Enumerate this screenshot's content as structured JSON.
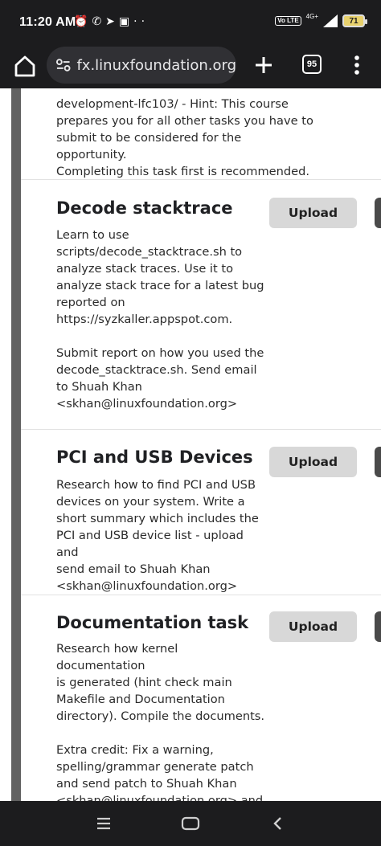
{
  "status_bar": {
    "time": "11:20 AM",
    "left_icons": [
      "alarm-icon",
      "whatsapp-icon",
      "telegram-icon",
      "train-icon",
      "more-dots-icon"
    ],
    "network": "4G+",
    "volte": "Vo LTE",
    "battery": "71"
  },
  "browser": {
    "url": "fx.linuxfoundation.org",
    "tab_count": "95"
  },
  "tasks": [
    {
      "title": "",
      "description": "development-lfc103/ - Hint: This course\nprepares you for all other tasks you have to\nsubmit to be considered for the opportunity.\nCompleting this task first is recommended."
    },
    {
      "title": "Decode stacktrace",
      "upload_label": "Upload",
      "description": "Learn to use\nscripts/decode_stacktrace.sh to\nanalyze stack traces. Use it to\nanalyze stack trace for a latest bug\nreported on\nhttps://syzkaller.appspot.com.\n\nSubmit report on how you used the\ndecode_stacktrace.sh. Send email\nto Shuah Khan\n<skhan@linuxfoundation.org>"
    },
    {
      "title": "PCI and USB Devices",
      "upload_label": "Upload",
      "description": "Research how to find PCI and USB\ndevices on your system. Write a\nshort summary which includes the\nPCI and USB device list - upload and\nsend email to Shuah Khan\n<skhan@linuxfoundation.org>"
    },
    {
      "title": "Documentation task",
      "upload_label": "Upload",
      "description": "Research how kernel documentation\nis generated (hint check main\nMakefile and Documentation\ndirectory). Compile the documents.\n\nExtra credit: Fix a warning,\nspelling/grammar generate patch\nand send patch to Shuah Khan\n<skhan@linuxfoundation.org> and\nalso submit the file. You can send"
    }
  ]
}
